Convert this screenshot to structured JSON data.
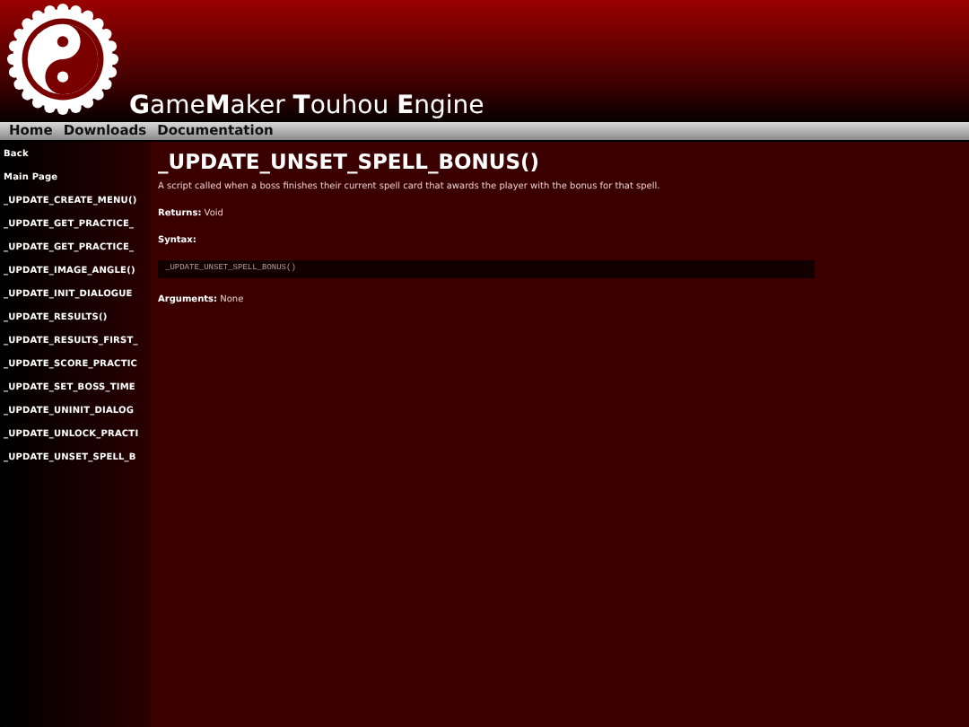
{
  "header": {
    "title": "**G**ame**M**aker **T**ouhou **E**ngine"
  },
  "nav": [
    "Home",
    "Downloads",
    "Documentation"
  ],
  "sidebar": {
    "items": [
      "Back",
      "Main Page",
      "_UPDATE_CREATE_MENU()",
      "_UPDATE_GET_PRACTICE_",
      "_UPDATE_GET_PRACTICE_",
      "_UPDATE_IMAGE_ANGLE()",
      "_UPDATE_INIT_DIALOGUE",
      "_UPDATE_RESULTS()",
      "_UPDATE_RESULTS_FIRST_",
      "_UPDATE_SCORE_PRACTIC",
      "_UPDATE_SET_BOSS_TIME",
      "_UPDATE_UNINIT_DIALOG",
      "_UPDATE_UNLOCK_PRACTI",
      "_UPDATE_UNSET_SPELL_B"
    ]
  },
  "content": {
    "heading": "_UPDATE_UNSET_SPELL_BONUS()",
    "description": "A script called when a boss finishes their current spell card that awards the player with the bonus for that spell.",
    "returns": {
      "label": "Returns:",
      "value": "Void"
    },
    "syntax": {
      "label": "Syntax:",
      "code": "_UPDATE_UNSET_SPELL_BONUS()"
    },
    "arguments": {
      "label": "Arguments:",
      "value": "None"
    }
  }
}
